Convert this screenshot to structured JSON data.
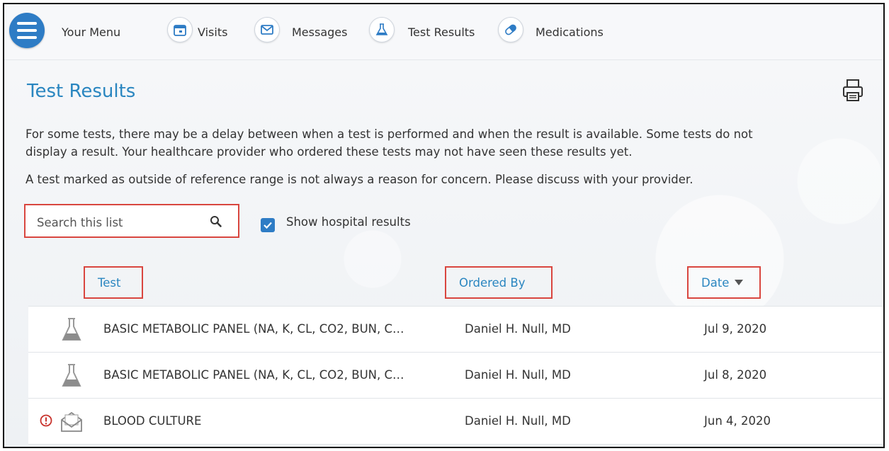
{
  "nav": {
    "menu_label": "Your Menu",
    "items": [
      {
        "label": "Visits",
        "icon": "calendar-icon"
      },
      {
        "label": "Messages",
        "icon": "envelope-icon"
      },
      {
        "label": "Test Results",
        "icon": "flask-icon"
      },
      {
        "label": "Medications",
        "icon": "pills-icon"
      }
    ]
  },
  "page": {
    "title": "Test Results",
    "description_line1": "For some tests, there may be a delay between when a test is performed and when the result is available. Some tests do not",
    "description_line2": "display a result. Your healthcare provider who ordered these tests may not have seen these results yet.",
    "description_line3": "A test marked as outside of reference range is not always a reason for concern. Please discuss with your provider."
  },
  "filters": {
    "search_placeholder": "Search this list",
    "search_value": "",
    "show_hospital_label": "Show hospital results",
    "show_hospital_checked": true
  },
  "table": {
    "headers": {
      "test": "Test",
      "ordered_by": "Ordered By",
      "date": "Date"
    },
    "rows": [
      {
        "test": "BASIC METABOLIC PANEL (NA, K, CL, CO2, BUN, C…",
        "ordered_by": "Daniel H. Null, MD",
        "date": "Jul 9, 2020",
        "icon": "flask-icon",
        "alert": false
      },
      {
        "test": "BASIC METABOLIC PANEL (NA, K, CL, CO2, BUN, C…",
        "ordered_by": "Daniel H. Null, MD",
        "date": "Jul 8, 2020",
        "icon": "flask-icon",
        "alert": false
      },
      {
        "test": "BLOOD CULTURE",
        "ordered_by": "Daniel H. Null, MD",
        "date": "Jun 4, 2020",
        "icon": "open-envelope-icon",
        "alert": true
      }
    ]
  },
  "colors": {
    "accent": "#2a86c0",
    "menu_button": "#2e7cc5",
    "highlight_border": "#d9463f",
    "alert": "#c8322c"
  }
}
